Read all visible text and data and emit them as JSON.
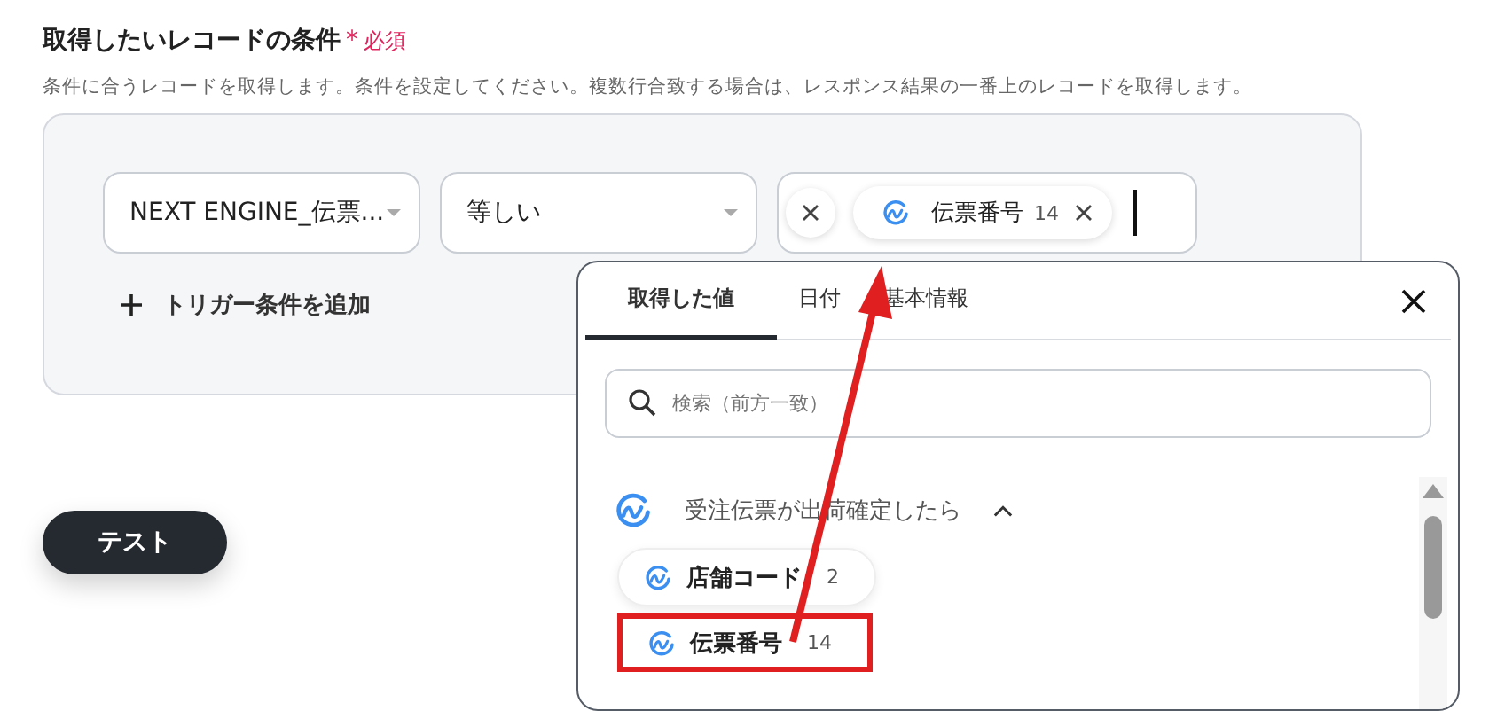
{
  "header": {
    "title": "取得したいレコードの条件",
    "required_mark": "*",
    "required_label": "必須",
    "description": "条件に合うレコードを取得します。条件を設定してください。複数行合致する場合は、レスポンス結果の一番上のレコードを取得します。"
  },
  "condition": {
    "field": "NEXT ENGINE_伝票...",
    "operator": "等しい",
    "value_chip": {
      "label": "伝票番号",
      "count": "14"
    }
  },
  "add_condition_button": "トリガー条件を追加",
  "test_button": "テスト",
  "popover": {
    "tabs": [
      {
        "label": "取得した値",
        "selected": true
      },
      {
        "label": "日付",
        "selected": false
      },
      {
        "label": "基本情報",
        "selected": false
      }
    ],
    "search": {
      "placeholder": "検索（前方一致）"
    },
    "group": {
      "title": "受注伝票が出荷確定したら",
      "expanded": true,
      "items": [
        {
          "label": "店舗コード",
          "count": "2",
          "highlighted": false
        },
        {
          "label": "伝票番号",
          "count": "14",
          "highlighted": true
        }
      ]
    }
  }
}
